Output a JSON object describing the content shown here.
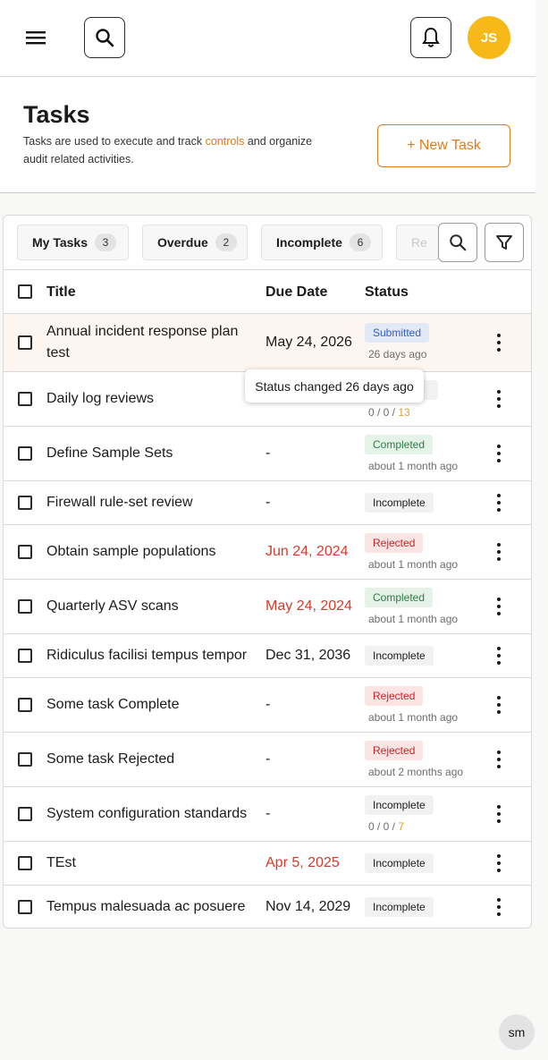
{
  "topbar": {
    "menu_icon": "hamburger-icon",
    "search_icon": "search-icon",
    "bell_icon": "bell-icon",
    "avatar_initials": "JS",
    "avatar_color": "#f7b917"
  },
  "header": {
    "title": "Tasks",
    "desc_before": "Tasks are used to execute and track ",
    "desc_link": "controls",
    "desc_after": " and organize audit related activities.",
    "new_task_label": "+ New Task",
    "accent_color": "#e07b1a"
  },
  "filters": {
    "chips": [
      {
        "label": "My Tasks",
        "count": "3"
      },
      {
        "label": "Overdue",
        "count": "2"
      },
      {
        "label": "Incomplete",
        "count": "6"
      },
      {
        "label": "Re"
      }
    ]
  },
  "table": {
    "columns": [
      "Title",
      "Due Date",
      "Status"
    ],
    "rows": [
      {
        "title": "Annual incident response plan test",
        "due": "May 24, 2026",
        "status": "Submitted",
        "sub": "26 days ago"
      },
      {
        "title": "Daily log reviews",
        "due": "",
        "status": "",
        "sub_a": "0 / 0 / ",
        "sub_b": "13"
      },
      {
        "title": "Define Sample Sets",
        "due": "-",
        "status": "Completed",
        "sub": "about 1 month ago"
      },
      {
        "title": "Firewall rule-set review",
        "due": "-",
        "status": "Incomplete"
      },
      {
        "title": "Obtain sample populations",
        "due": "Jun 24, 2024",
        "status": "Rejected",
        "sub": "about 1 month ago"
      },
      {
        "title": "Quarterly ASV scans",
        "due": "May 24, 2024",
        "status": "Completed",
        "sub": "about 1 month ago"
      },
      {
        "title": "Ridiculus facilisi tempus tempor",
        "due": "Dec 31, 2036",
        "status": "Incomplete"
      },
      {
        "title": "Some task Complete",
        "due": "-",
        "status": "Rejected",
        "sub": "about 1 month ago"
      },
      {
        "title": "Some task Rejected",
        "due": "-",
        "status": "Rejected",
        "sub": "about 2 months ago"
      },
      {
        "title": "System configuration standards",
        "due": "-",
        "status": "Incomplete",
        "sub_a": "0 / 0 / ",
        "sub_b": "7"
      },
      {
        "title": "TEst",
        "due": "Apr 5, 2025",
        "status": "Incomplete"
      },
      {
        "title": "Tempus malesuada ac posuere",
        "due": "Nov 14, 2029",
        "status": "Incomplete"
      }
    ]
  },
  "tooltip": "Status changed 26 days ago",
  "bottom_avatar": "sm"
}
